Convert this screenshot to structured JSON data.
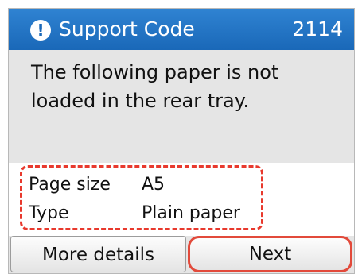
{
  "header": {
    "icon": "exclamation-circle-icon",
    "title": "Support Code",
    "code": "2114"
  },
  "message": "The following paper is not loaded in the rear tray.",
  "details": [
    {
      "label": "Page size",
      "value": "A5"
    },
    {
      "label": "Type",
      "value": "Plain paper"
    }
  ],
  "buttons": {
    "more_details": "More details",
    "next": "Next"
  },
  "colors": {
    "header": "#1a68b8",
    "highlight": "#e8392d"
  }
}
